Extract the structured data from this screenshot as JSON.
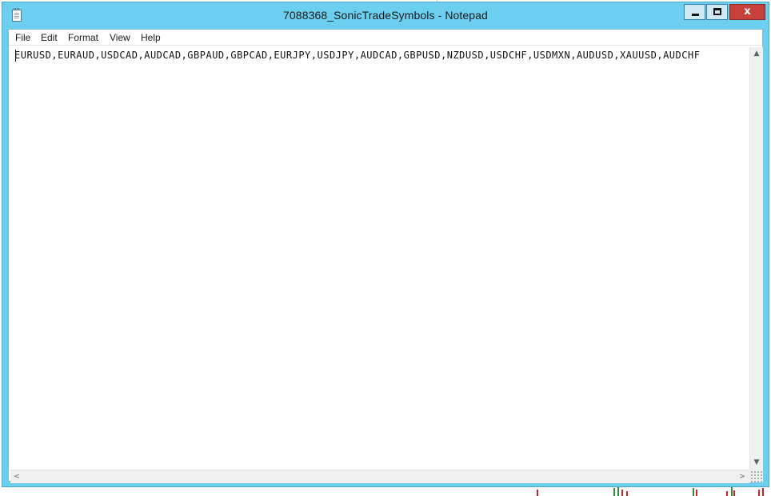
{
  "window": {
    "title": "7088368_SonicTradeSymbols - Notepad",
    "icon": "notepad-icon",
    "controls": {
      "minimize_glyph": "",
      "maximize_glyph": "",
      "close_glyph": "x"
    },
    "accent_color": "#6ccff0",
    "close_color": "#c7413a"
  },
  "menubar": {
    "items": [
      {
        "label": "File"
      },
      {
        "label": "Edit"
      },
      {
        "label": "Format"
      },
      {
        "label": "View"
      },
      {
        "label": "Help"
      }
    ]
  },
  "editor": {
    "content": "EURUSD,EURAUD,USDCAD,AUDCAD,GBPAUD,GBPCAD,EURJPY,USDJPY,AUDCAD,GBPUSD,NZDUSD,USDCHF,USDMXN,AUDUSD,XAUUSD,AUDCHF"
  },
  "scrollbars": {
    "up_arrow": "▲",
    "down_arrow": "▼",
    "left_arrow": "<",
    "right_arrow": ">"
  }
}
